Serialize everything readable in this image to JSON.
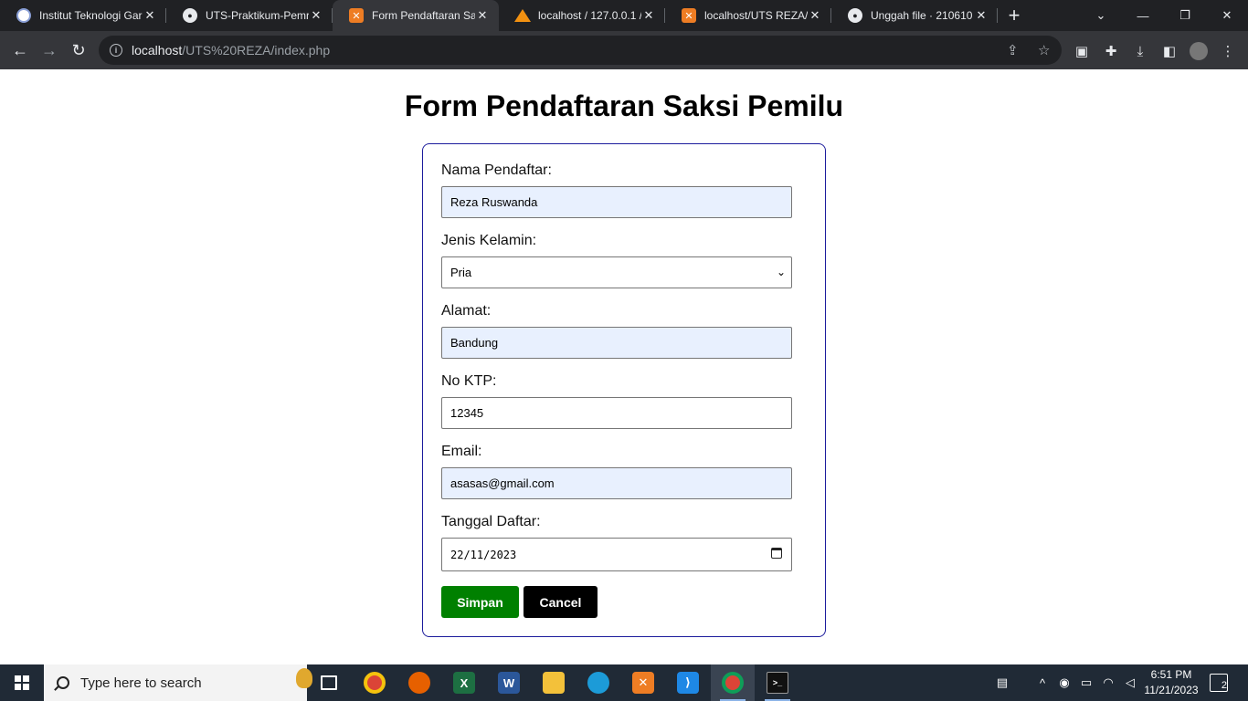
{
  "browser": {
    "tabs": [
      {
        "title": "Institut Teknologi Gar",
        "favicon": "itg-icon"
      },
      {
        "title": "UTS-Praktikum-Pemro",
        "favicon": "github-icon"
      },
      {
        "title": "Form Pendaftaran Sak",
        "favicon": "xampp-icon",
        "active": true
      },
      {
        "title": "localhost / 127.0.0.1 /",
        "favicon": "phpmyadmin-icon"
      },
      {
        "title": "localhost/UTS REZA/i",
        "favicon": "xampp-icon"
      },
      {
        "title": "Unggah file · 210610",
        "favicon": "github-icon"
      }
    ],
    "url_host": "localhost",
    "url_path": "/UTS%20REZA/index.php"
  },
  "page": {
    "title": "Form Pendaftaran Saksi Pemilu",
    "fields": {
      "nama": {
        "label": "Nama Pendaftar:",
        "value": "Reza Ruswanda"
      },
      "jenis_kelamin": {
        "label": "Jenis Kelamin:",
        "value": "Pria"
      },
      "alamat": {
        "label": "Alamat:",
        "value": "Bandung"
      },
      "ktp": {
        "label": "No KTP:",
        "value": "12345"
      },
      "email": {
        "label": "Email:",
        "value": "asasas@gmail.com"
      },
      "tanggal": {
        "label": "Tanggal Daftar:",
        "value": "22/11/2023"
      }
    },
    "buttons": {
      "save": "Simpan",
      "cancel": "Cancel"
    },
    "colors": {
      "save": "#008000",
      "cancel": "#000000",
      "card_border": "#1c1c9c"
    }
  },
  "taskbar": {
    "search_placeholder": "Type here to search",
    "time": "6:51 PM",
    "date": "11/21/2023",
    "notifications": "2"
  }
}
